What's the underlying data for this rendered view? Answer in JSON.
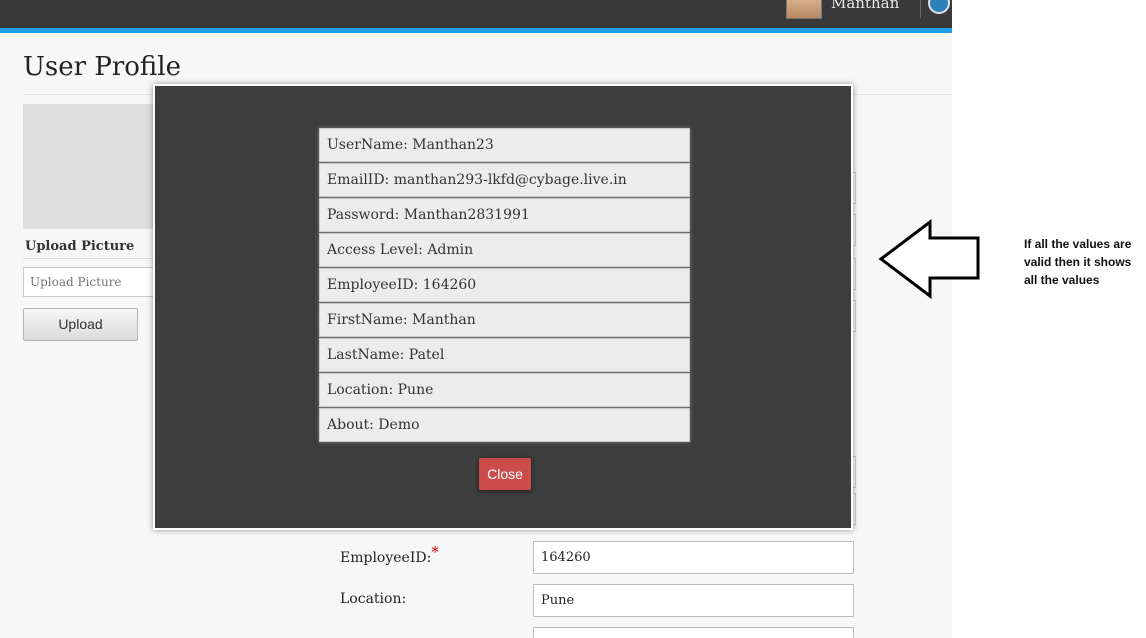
{
  "header": {
    "username": "Manthan"
  },
  "page": {
    "title": "User Profile"
  },
  "sidebar": {
    "upload_label": "Upload Picture",
    "upload_placeholder": "Upload Picture",
    "upload_button": "Upload"
  },
  "form": {
    "employee_id_label": "EmployeeID:",
    "required_mark": "*",
    "employee_id_value": "164260",
    "location_label": "Location:",
    "location_value": "Pune"
  },
  "modal": {
    "rows": [
      "UserName: Manthan23",
      "EmailID: manthan293-lkfd@cybage.live.in",
      "Password: Manthan2831991",
      "Access Level: Admin",
      "EmployeeID: 164260",
      "FirstName: Manthan",
      "LastName: Patel",
      "Location: Pune",
      "About: Demo"
    ],
    "close_label": "Close"
  },
  "annotation": {
    "note": "If all the values are valid then it shows all the values"
  },
  "colors": {
    "topbar": "#3a3a3a",
    "accent": "#1ea0e6",
    "modal_bg": "#3d3d3d",
    "close_button": "#cc4b4b",
    "required": "#dd0000"
  }
}
